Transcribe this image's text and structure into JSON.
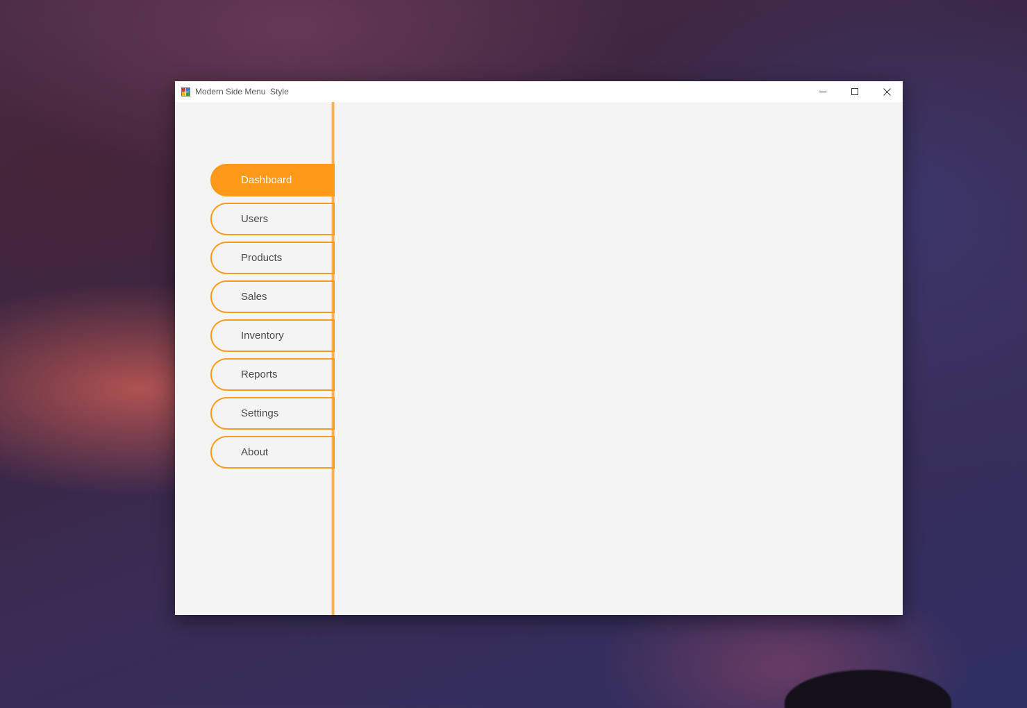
{
  "window": {
    "title": "Modern Side Menu  Style",
    "icon": "app-icon",
    "controls": {
      "minimize_icon": "minimize-icon",
      "maximize_icon": "maximize-icon",
      "close_icon": "close-icon"
    }
  },
  "sidebar": {
    "accent_color": "#ff991a",
    "active_index": 0,
    "items": [
      {
        "label": "Dashboard"
      },
      {
        "label": "Users"
      },
      {
        "label": "Products"
      },
      {
        "label": "Sales"
      },
      {
        "label": "Inventory"
      },
      {
        "label": "Reports"
      },
      {
        "label": "Settings"
      },
      {
        "label": "About"
      }
    ]
  },
  "colors": {
    "accent": "#ff991a",
    "window_bg": "#f4f4f4",
    "titlebar_bg": "#ffffff",
    "menu_text": "#4a4a4a",
    "active_text": "#ffffff"
  }
}
